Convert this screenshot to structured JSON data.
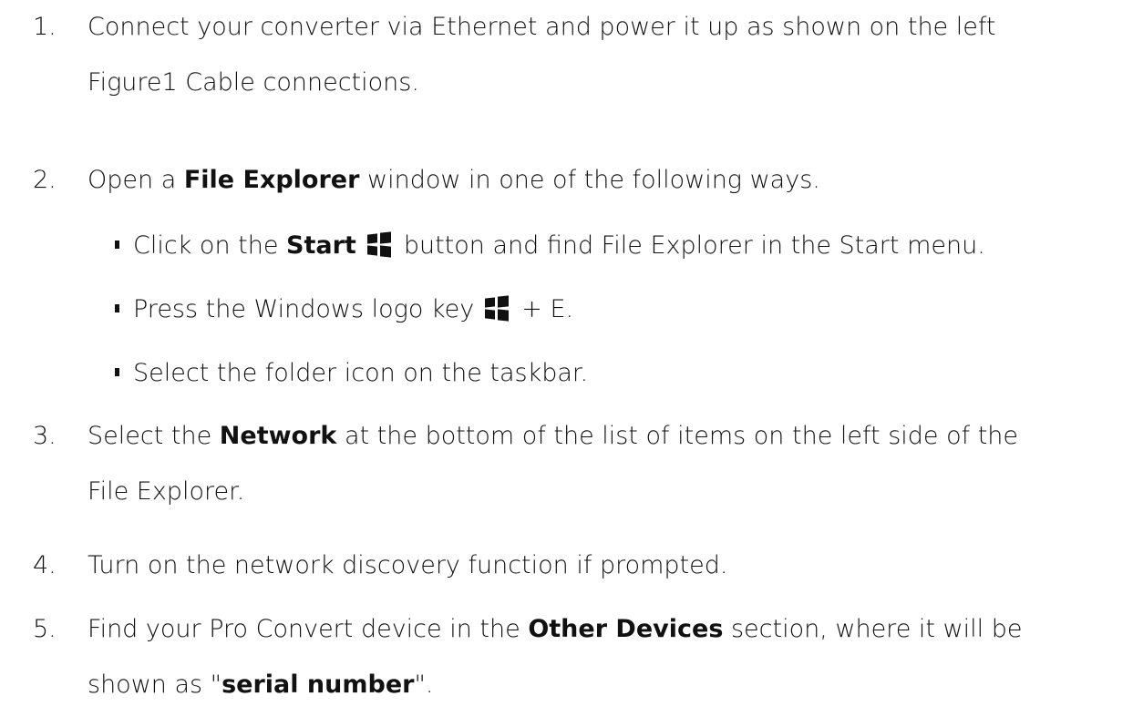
{
  "steps": [
    {
      "number": "1.",
      "line1": "Connect your converter via Ethernet and power it up as shown on the left",
      "line2": "Figure1 Cable connections."
    },
    {
      "number": "2.",
      "pre": "Open a ",
      "bold": "File Explorer",
      "post": " window in one of the following ways.",
      "bullets": [
        {
          "pre": "Click on the ",
          "bold": "Start",
          "post": "button and find File Explorer in the Start menu."
        },
        {
          "pre": "Press the Windows logo key",
          "post": "+ E."
        },
        {
          "text": "Select the folder icon on the taskbar."
        }
      ]
    },
    {
      "number": "3.",
      "pre": "Select the ",
      "bold": "Network",
      "post": " at the bottom of the list of items on the left side of the",
      "line2": "File Explorer."
    },
    {
      "number": "4.",
      "text": "Turn on the network discovery function if prompted."
    },
    {
      "number": "5.",
      "pre": "Find your Pro Convert device in the ",
      "bold": "Other Devices",
      "post": " section, where it will be",
      "line2_pre": "shown as \"",
      "line2_bold": "serial number",
      "line2_post": "\"."
    }
  ],
  "icons": {
    "windows_logo": "windows-logo-icon",
    "bullet": "square-bullet"
  }
}
